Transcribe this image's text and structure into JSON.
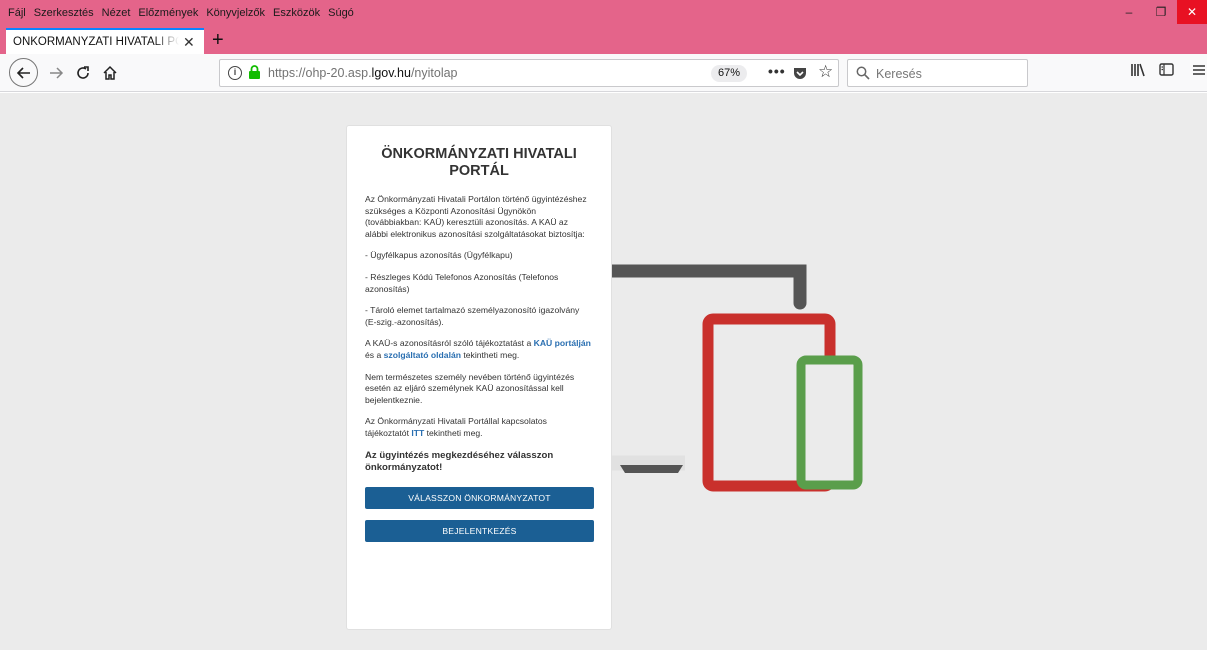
{
  "menubar": {
    "items": [
      "Fájl",
      "Szerkesztés",
      "Nézet",
      "Előzmények",
      "Könyvjelzők",
      "Eszközök",
      "Súgó"
    ]
  },
  "window_controls": {
    "minimize": "–",
    "restore": "❐",
    "close": "✕"
  },
  "tab": {
    "title": "ÖNKORMÁNYZATI HIVATALI PORTÁL",
    "close": "✕",
    "new_tab": "+"
  },
  "navbar": {
    "url_prefix": "https://ohp-20.asp.",
    "url_domain": "lgov.hu",
    "url_path": "/nyitolap",
    "zoom": "67%",
    "page_actions": "•••",
    "search_placeholder": "Keresés"
  },
  "card": {
    "title": "ÖNKORMÁNYZATI HIVATALI PORTÁL",
    "intro": "Az Önkormányzati Hivatali Portálon történő ügyintézéshez szükséges a Központi Azonosítási Ügynökön (továbbiakban: KAÜ) keresztüli azonosítás. A KAÜ az alábbi elektronikus azonosítási szolgáltatásokat biztosítja:",
    "option1": "- Ügyfélkapus azonosítás (Ügyfélkapu)",
    "option2": "- Részleges Kódú Telefonos Azonosítás (Telefonos azonosítás)",
    "option3": "- Tároló elemet tartalmazó személyazonosító igazolvány (E-szig.-azonosítás).",
    "info_pre": "A KAÜ-s azonosításról szóló tájékoztatást a ",
    "info_link1": "KAÜ portálján",
    "info_mid": " és a ",
    "info_link2": "szolgáltató oldalán",
    "info_post": " tekintheti meg.",
    "legal": "Nem természetes személy nevében történő ügyintézés esetén az eljáró személynek KAÜ azonosítással kell bejelentkeznie.",
    "portal_pre": "Az Önkormányzati Hivatali Portállal kapcsolatos tájékoztatót ",
    "portal_link": "ITT",
    "portal_post": " tekintheti meg.",
    "cta": "Az ügyintézés megkezdéséhez válasszon önkormányzatot!",
    "btn_select": "VÁLASSZON ÖNKORMÁNYZATOT",
    "btn_login": "BEJELENTKEZÉS"
  },
  "colors": {
    "menubar": "#e4648a",
    "button": "#1b5f94",
    "link": "#2a6fb1",
    "device_gray": "#555555",
    "device_red": "#c9302c",
    "device_green": "#5a9e4b"
  }
}
